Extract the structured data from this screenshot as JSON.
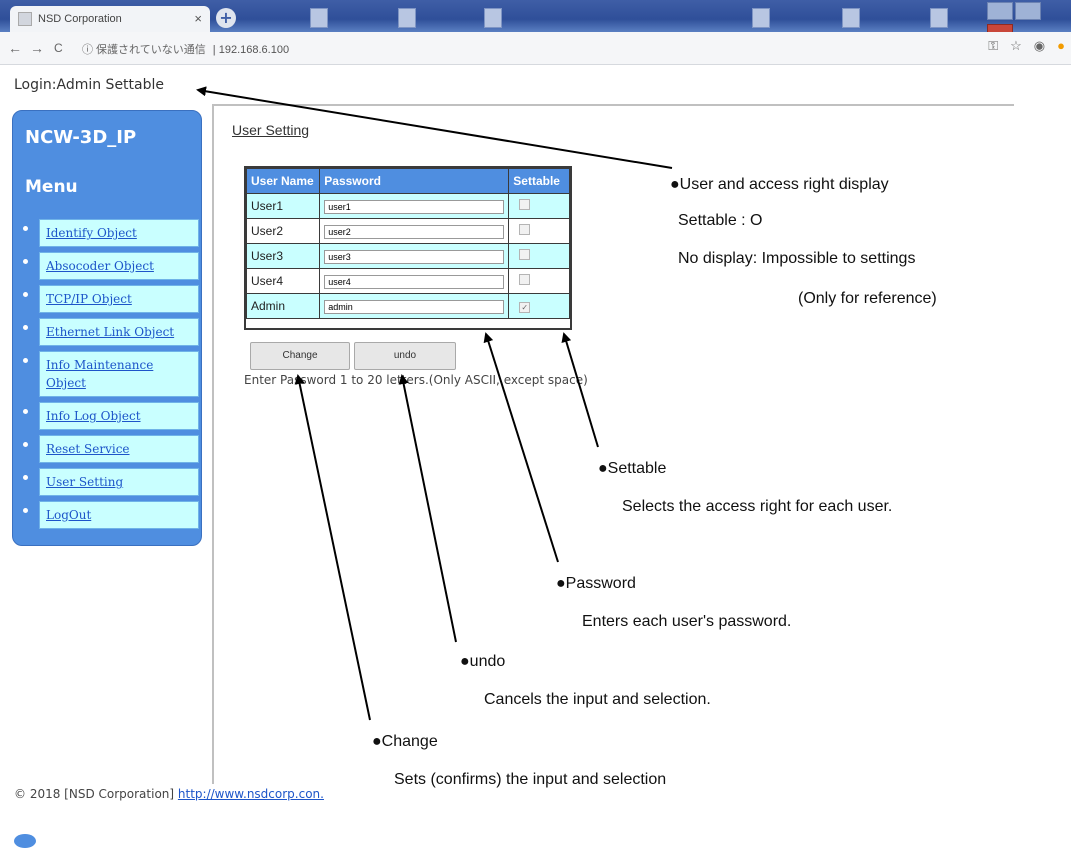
{
  "browser": {
    "tab_title": "NSD Corporation",
    "tab_close": "×",
    "new_tab": "+",
    "nav_back": "←",
    "nav_forward": "→",
    "nav_reload": "C",
    "security_label": "ⓘ 保護されていない通信",
    "url": "192.168.6.100",
    "right_icons": [
      "key-icon",
      "star-icon",
      "account-icon",
      "warning-icon"
    ]
  },
  "page": {
    "login_status": "Login:Admin Settable",
    "sidebar": {
      "title": "NCW-3D_IP",
      "menu_heading": "Menu",
      "items": [
        {
          "label": "Identify Object"
        },
        {
          "label": "Absocoder Object"
        },
        {
          "label": "TCP/IP Object"
        },
        {
          "label": "Ethernet Link Object"
        },
        {
          "label": "Info Maintenance Object"
        },
        {
          "label": "Info Log Object"
        },
        {
          "label": "Reset Service"
        },
        {
          "label": "User Setting"
        },
        {
          "label": "LogOut"
        }
      ]
    },
    "heading": "User Setting",
    "table": {
      "columns": [
        "User Name",
        "Password",
        "Settable"
      ],
      "rows": [
        {
          "user": "User1",
          "password": "user1",
          "settable": false
        },
        {
          "user": "User2",
          "password": "user2",
          "settable": false
        },
        {
          "user": "User3",
          "password": "user3",
          "settable": false
        },
        {
          "user": "User4",
          "password": "user4",
          "settable": false
        },
        {
          "user": "Admin",
          "password": "admin",
          "settable": true
        }
      ]
    },
    "buttons": {
      "change": "Change",
      "undo": "undo"
    },
    "hint": "Enter Password 1 to 20 letters.(Only ASCII, except space)",
    "footer_text": "© 2018 [NSD Corporation]",
    "footer_link": "http://www.nsdcorp.con."
  },
  "annotations": {
    "access_display": {
      "title": "●User and access right display",
      "line1": "Settable  : O",
      "line2": "No display: Impossible to settings",
      "line3": "(Only for reference)"
    },
    "settable": {
      "title": "●Settable",
      "desc": "Selects the access right for each user."
    },
    "password": {
      "title": "●Password",
      "desc": "Enters each user's password."
    },
    "undo": {
      "title": "●undo",
      "desc": "Cancels the input and selection."
    },
    "change": {
      "title": "●Change",
      "desc": "Sets (confirms) the input and selection"
    }
  },
  "colors": {
    "sidebar": "#4f8ee0",
    "menu_item_bg": "#c9ffff",
    "link": "#1d55c9",
    "table_header": "#4f8ee0"
  }
}
